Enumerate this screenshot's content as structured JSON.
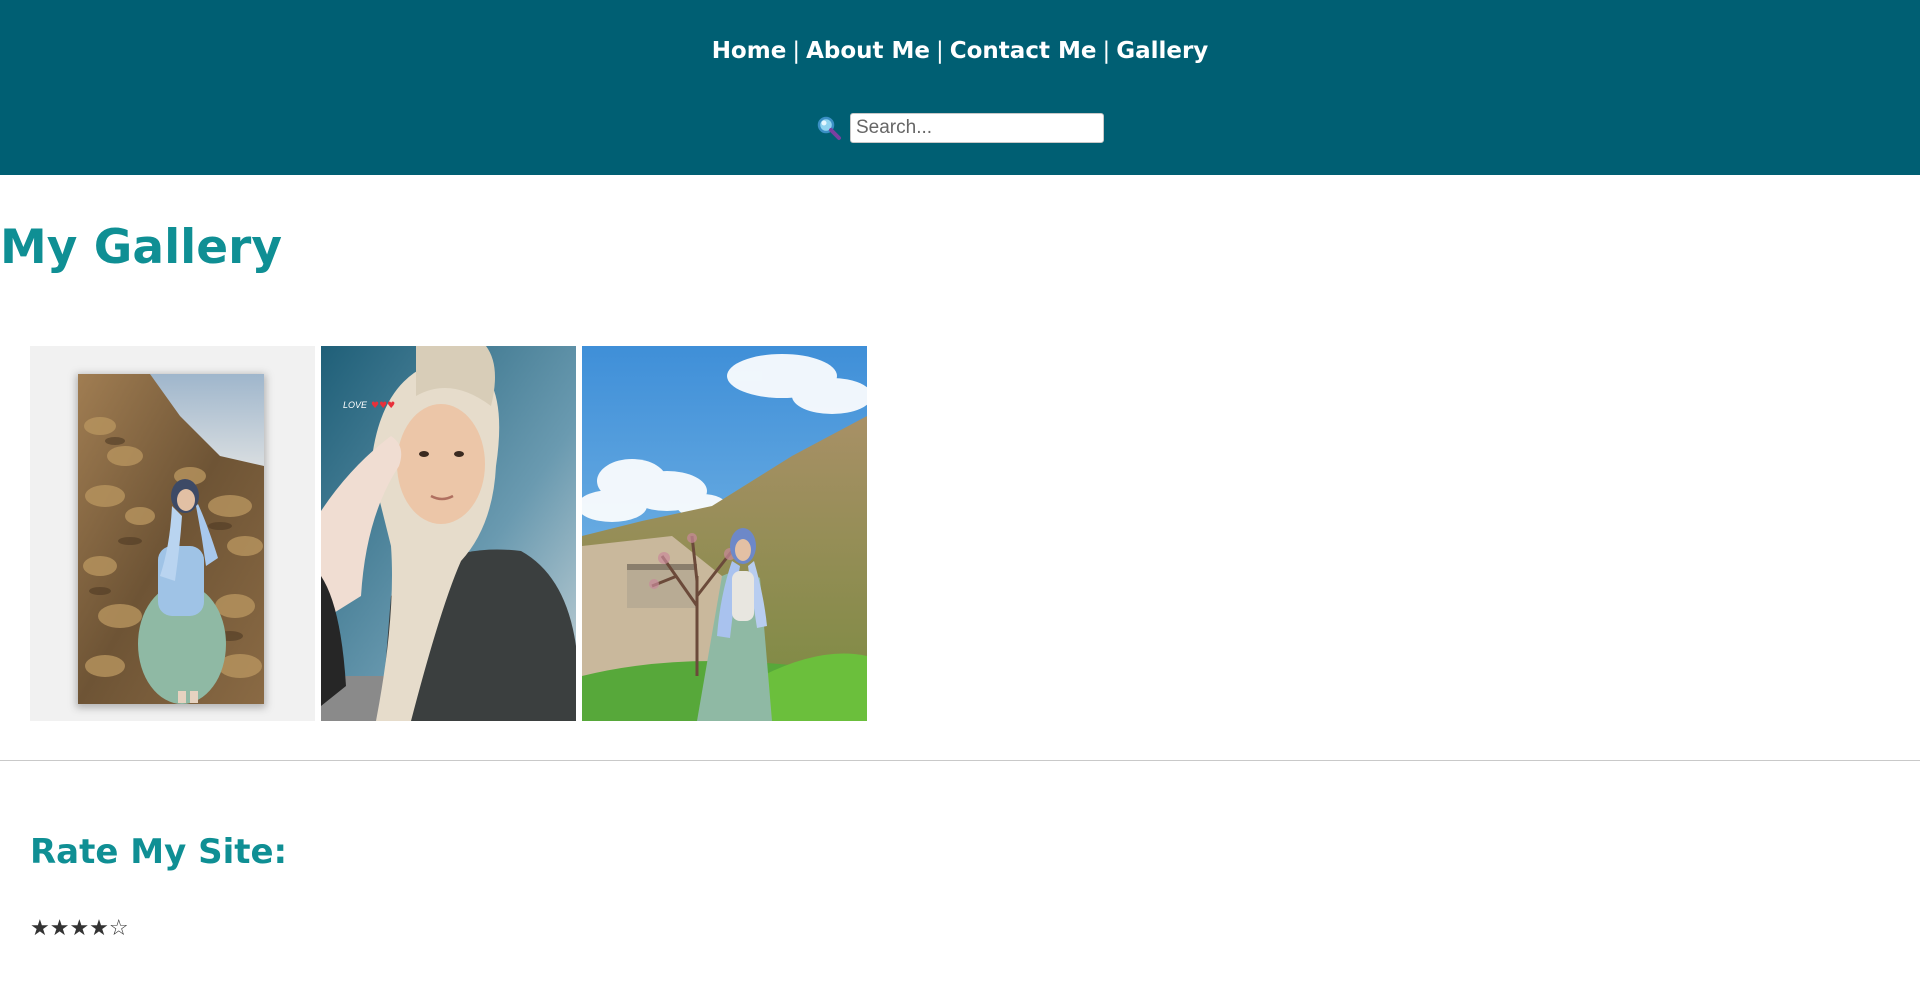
{
  "header": {
    "nav": [
      {
        "label": "Home"
      },
      {
        "label": "About Me"
      },
      {
        "label": "Contact Me"
      },
      {
        "label": "Gallery"
      }
    ],
    "separator": "|",
    "search": {
      "icon": "search-icon",
      "placeholder": "Search...",
      "value": ""
    },
    "background_color": "#005f73"
  },
  "main": {
    "title": "My Gallery",
    "photos": [
      {
        "name": "photo-girl-sitting-on-stone-wall"
      },
      {
        "name": "photo-girl-selfie-hijab",
        "overlay_text": "LOVE"
      },
      {
        "name": "photo-girl-standing-by-tree"
      }
    ]
  },
  "rating": {
    "title": "Rate My Site:",
    "stars": "★★★★☆",
    "value": 4,
    "max": 5
  },
  "colors": {
    "accent": "#0f8f94",
    "header": "#005f73"
  }
}
